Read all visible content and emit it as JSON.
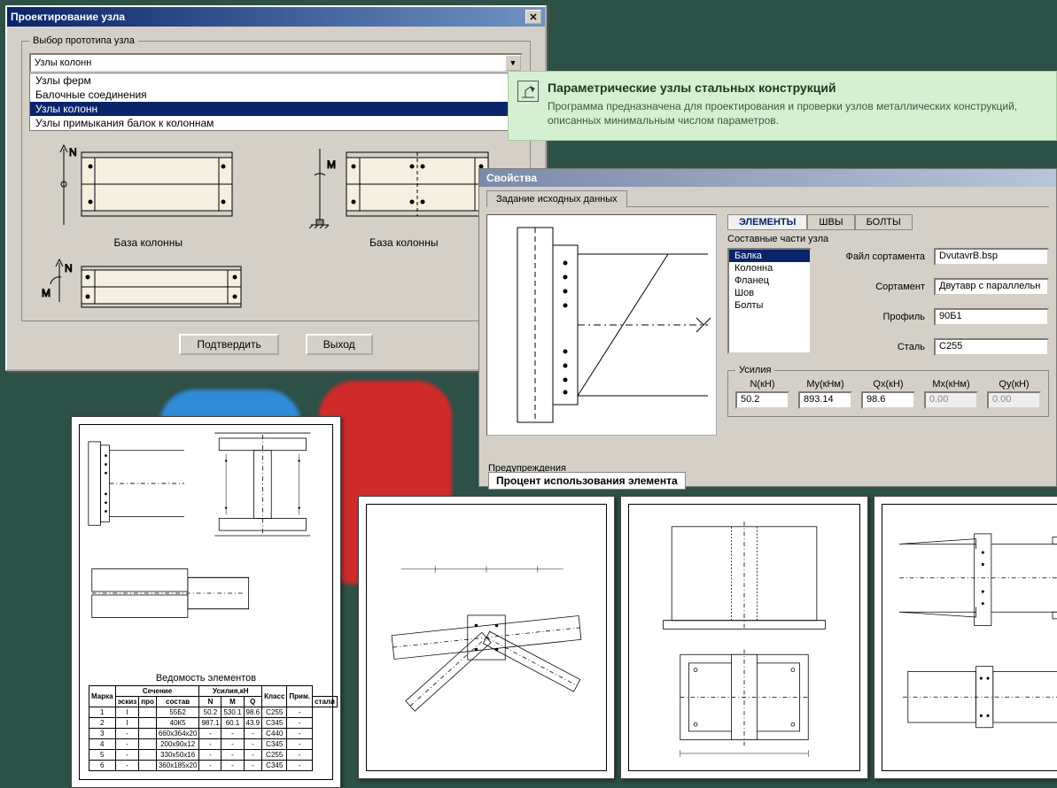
{
  "dlg1": {
    "title": "Проектирование узла",
    "group": "Выбор прототипа узла",
    "combo_value": "Узлы колонн",
    "options": [
      {
        "label": "Узлы ферм",
        "sel": false
      },
      {
        "label": "Балочные соединения",
        "sel": false
      },
      {
        "label": "Узлы колонн",
        "sel": true
      },
      {
        "label": "Узлы примыкания балок к колоннам",
        "sel": false
      }
    ],
    "thumb1_cap": "База колонны",
    "thumb2_cap": "База колонны",
    "btn_ok": "Подтвердить",
    "btn_cancel": "Выход"
  },
  "banner": {
    "title": "Параметрические узлы стальных конструкций",
    "text": "Программа предназначена для проектирования и проверки узлов металлических конструкций, описанных минимальным числом параметров."
  },
  "props": {
    "title": "Свойства",
    "tab1": "Задание исходных данных",
    "subtabs": [
      "ЭЛЕМЕНТЫ",
      "ШВЫ",
      "БОЛТЫ"
    ],
    "subtitle": "Составные части узла",
    "parts": [
      "Балка",
      "Колонна",
      "Фланец",
      "Шов",
      "Болты"
    ],
    "parts_sel": 0,
    "flabels": {
      "file": "Файл сортамента",
      "sort": "Сортамент",
      "prof": "Профиль",
      "steel": "Сталь"
    },
    "fvals": {
      "file": "DvutavrB.bsp",
      "sort": "Двутавр с параллельн",
      "prof": "90Б1",
      "steel": "С255"
    },
    "forces_legend": "Усилия",
    "forces": [
      {
        "label": "N(кН)",
        "val": "50.2",
        "dis": false
      },
      {
        "label": "My(кНм)",
        "val": "893.14",
        "dis": false
      },
      {
        "label": "Qx(кН)",
        "val": "98.6",
        "dis": false
      },
      {
        "label": "Mx(кНм)",
        "val": "0.00",
        "dis": true
      },
      {
        "label": "Qy(кН)",
        "val": "0.00",
        "dis": true
      }
    ],
    "warn": "Предупреждения",
    "percent": "Процент использования элемента"
  },
  "sheet1": {
    "table_title": "Ведомость элементов",
    "head_top": [
      "Марка",
      "Сечение",
      "Усилия,кН",
      "Класс",
      "Прим."
    ],
    "head_sub": [
      "эскиз",
      "про",
      "состав",
      "N",
      "M",
      "Q",
      "стали"
    ],
    "rows": [
      [
        "1",
        "I",
        "",
        "55Б2",
        "50.2",
        "530.1",
        "98.6",
        "С255",
        "-"
      ],
      [
        "2",
        "I",
        "",
        "40К5",
        "987.1",
        "60.1",
        "43.9",
        "С345",
        "-"
      ],
      [
        "3",
        "-",
        "",
        "660x364x20",
        "-",
        "-",
        "-",
        "С440",
        "-"
      ],
      [
        "4",
        "-",
        "",
        "200x90x12",
        "-",
        "-",
        "-",
        "С345",
        "-"
      ],
      [
        "5",
        "-",
        "",
        "330x50x16",
        "-",
        "-",
        "-",
        "С255",
        "-"
      ],
      [
        "6",
        "-",
        "",
        "360x185x20",
        "-",
        "-",
        "-",
        "С345",
        "-"
      ]
    ]
  }
}
